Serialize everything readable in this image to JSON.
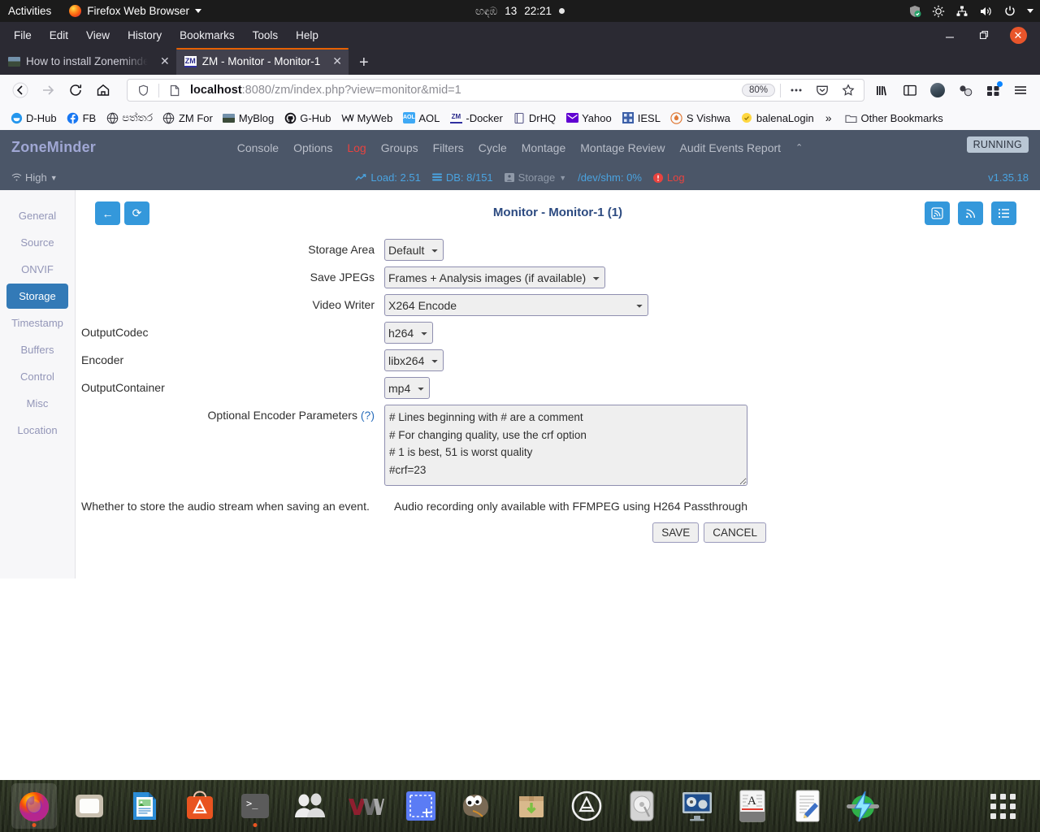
{
  "gnome": {
    "activities": "Activities",
    "app_menu": "Firefox Web Browser",
    "clock_locale_text": "ඟඳඹ",
    "clock_date": "13",
    "clock_time": "22:21",
    "tray_icons": [
      "shield-ok-icon",
      "brightness-icon",
      "network-icon",
      "volume-icon",
      "power-icon",
      "chevron-down-icon"
    ]
  },
  "browser": {
    "menus": [
      "File",
      "Edit",
      "View",
      "History",
      "Bookmarks",
      "Tools",
      "Help"
    ],
    "window_controls": {
      "minimize": "—",
      "restore": "❐",
      "close": "✕"
    },
    "tabs": [
      {
        "title": "How to install Zoneminder",
        "favicon": "photo-favicon",
        "active": false
      },
      {
        "title": "ZM - Monitor - Monitor-1",
        "favicon": "zm-favicon",
        "active": true
      }
    ],
    "new_tab_label": "+",
    "url_prefix": "localhost",
    "url_suffix": ":8080/zm/index.php?view=monitor&mid=1",
    "zoom_level": "80%",
    "toolbar_icons": [
      "back-icon",
      "forward-icon",
      "reload-icon",
      "home-icon",
      "shield-icon",
      "page-icon",
      "ellipsis-icon",
      "pocket-icon",
      "bookmark-star-icon",
      "library-icon",
      "reader-sidebar-icon",
      "account-avatar-icon",
      "extension-icon",
      "addons-icon",
      "hamburger-menu-icon"
    ],
    "bookmarks": [
      {
        "label": "D-Hub",
        "icon": "docker-icon"
      },
      {
        "label": "FB",
        "icon": "facebook-icon"
      },
      {
        "label": "පත්තර",
        "icon": "globe-icon"
      },
      {
        "label": "ZM For",
        "icon": "globe-icon"
      },
      {
        "label": "MyBlog",
        "icon": "photo-icon"
      },
      {
        "label": "G-Hub",
        "icon": "github-icon"
      },
      {
        "label": "MyWeb",
        "icon": "w-icon"
      },
      {
        "label": "AOL",
        "icon": "aol-icon"
      },
      {
        "label": "-Docker",
        "icon": "zm-icon"
      },
      {
        "label": "DrHQ",
        "icon": "book-icon"
      },
      {
        "label": "Yahoo",
        "icon": "mail-icon"
      },
      {
        "label": "IESL",
        "icon": "grid-icon"
      },
      {
        "label": "S Vishwa",
        "icon": "badge-icon"
      },
      {
        "label": "balenaLogin",
        "icon": "balena-icon"
      }
    ],
    "bookmarks_overflow": "»",
    "other_bookmarks": "Other Bookmarks"
  },
  "zoneminder": {
    "brand": "ZoneMinder",
    "nav": [
      {
        "label": "Console",
        "highlight": false
      },
      {
        "label": "Options",
        "highlight": false
      },
      {
        "label": "Log",
        "highlight": true
      },
      {
        "label": "Groups",
        "highlight": false
      },
      {
        "label": "Filters",
        "highlight": false
      },
      {
        "label": "Cycle",
        "highlight": false
      },
      {
        "label": "Montage",
        "highlight": false
      },
      {
        "label": "Montage Review",
        "highlight": false
      },
      {
        "label": "Audit Events Report",
        "highlight": false
      }
    ],
    "nav_collapse_caret": "⌃",
    "status_badge": "RUNNING",
    "bandwidth": "High",
    "stats": {
      "load": "Load: 2.51",
      "db": "DB: 8/151",
      "storage": "Storage",
      "shm": "/dev/shm: 0%",
      "log": "Log"
    },
    "version": "v1.35.18",
    "sidebar": [
      {
        "label": "General",
        "active": false
      },
      {
        "label": "Source",
        "active": false
      },
      {
        "label": "ONVIF",
        "active": false
      },
      {
        "label": "Storage",
        "active": true
      },
      {
        "label": "Timestamp",
        "active": false
      },
      {
        "label": "Buffers",
        "active": false
      },
      {
        "label": "Control",
        "active": false
      },
      {
        "label": "Misc",
        "active": false
      },
      {
        "label": "Location",
        "active": false
      }
    ],
    "page_title": "Monitor - Monitor-1 (1)",
    "top_buttons": {
      "back": "←",
      "refresh": "⟳"
    },
    "top_right_buttons": [
      "rss-box-icon",
      "rss-icon",
      "list-icon"
    ],
    "form": {
      "storage_area": {
        "label": "Storage Area",
        "value": "Default"
      },
      "save_jpegs": {
        "label": "Save JPEGs",
        "value": "Frames + Analysis images (if available)"
      },
      "video_writer": {
        "label": "Video Writer",
        "value": "X264 Encode"
      },
      "output_codec": {
        "label": "OutputCodec",
        "value": "h264"
      },
      "encoder": {
        "label": "Encoder",
        "value": "libx264"
      },
      "output_container": {
        "label": "OutputContainer",
        "value": "mp4"
      },
      "optional_params": {
        "label": "Optional Encoder Parameters",
        "help_marker": "(?)",
        "value": "# Lines beginning with # are a comment\n# For changing quality, use the crf option\n# 1 is best, 51 is worst quality\n#crf=23"
      },
      "audio_left_note": "Whether to store the audio stream when saving an event.",
      "audio_right_note": "Audio recording only available with FFMPEG using H264 Passthrough",
      "save_label": "SAVE",
      "cancel_label": "CANCEL"
    }
  },
  "dock": {
    "items": [
      {
        "name": "firefox",
        "running": true,
        "active": true
      },
      {
        "name": "files",
        "running": false,
        "active": false
      },
      {
        "name": "libreoffice-writer",
        "running": false,
        "active": false
      },
      {
        "name": "ubuntu-software",
        "running": false,
        "active": false
      },
      {
        "name": "terminal",
        "running": true,
        "active": false
      },
      {
        "name": "users",
        "running": false,
        "active": false
      },
      {
        "name": "vmware",
        "running": false,
        "active": false
      },
      {
        "name": "screenshot",
        "running": false,
        "active": false
      },
      {
        "name": "gimp",
        "running": false,
        "active": false
      },
      {
        "name": "archive-manager",
        "running": false,
        "active": false
      },
      {
        "name": "ubuntu-amazon",
        "running": false,
        "active": false
      },
      {
        "name": "disks",
        "running": false,
        "active": false
      },
      {
        "name": "video-player",
        "running": false,
        "active": false
      },
      {
        "name": "fonts",
        "running": false,
        "active": false
      },
      {
        "name": "text-editor",
        "running": false,
        "active": false
      },
      {
        "name": "etcher",
        "running": false,
        "active": false
      }
    ],
    "show_apps_label": "Show Applications"
  },
  "colors": {
    "zm_header": "#4b5668",
    "zm_accent": "#337ab7",
    "firefox_orange": "#e66000",
    "log_red": "#e8433f",
    "stat_blue": "#4aa3e0"
  }
}
